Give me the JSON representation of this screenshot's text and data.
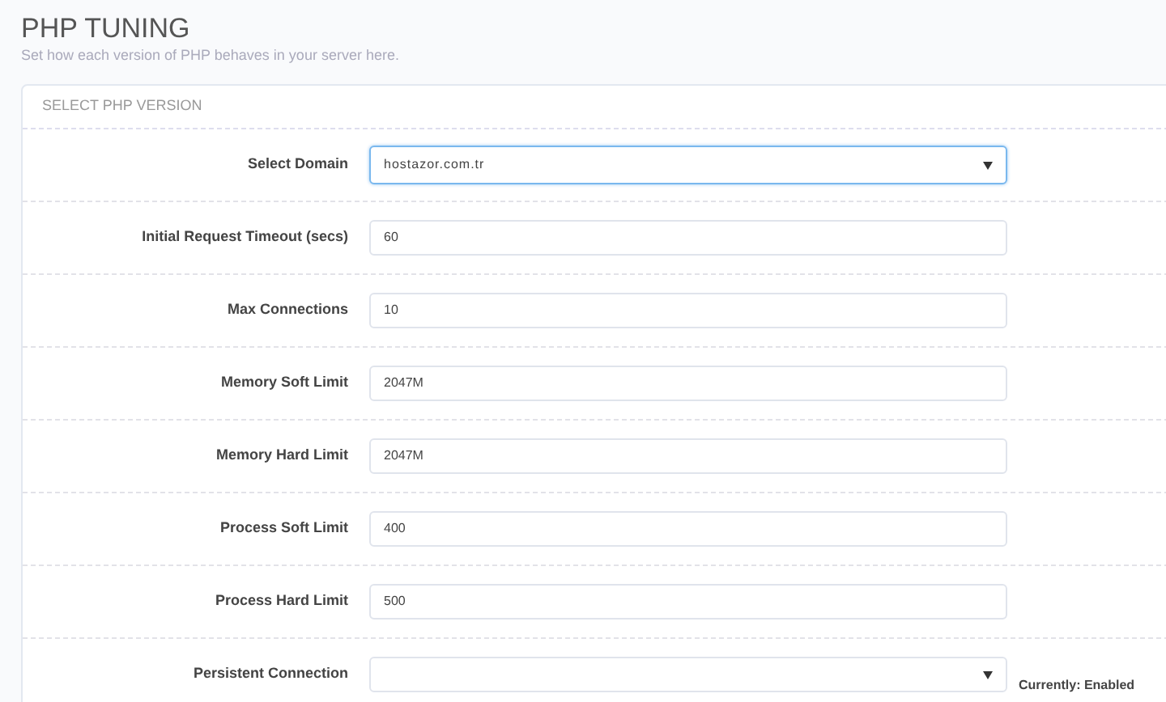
{
  "page": {
    "title": "PHP TUNING",
    "subtitle": "Set how each version of PHP behaves in your server here."
  },
  "card": {
    "header": "SELECT PHP VERSION",
    "fields": [
      {
        "kind": "select",
        "label": "Select Domain",
        "value": "hostazor.com.tr",
        "focused": true
      },
      {
        "kind": "input",
        "label": "Initial Request Timeout (secs)",
        "value": "60",
        "focused": false
      },
      {
        "kind": "input",
        "label": "Max Connections",
        "value": "10",
        "focused": false
      },
      {
        "kind": "input",
        "label": "Memory Soft Limit",
        "value": "2047M",
        "focused": false
      },
      {
        "kind": "input",
        "label": "Memory Hard Limit",
        "value": "2047M",
        "focused": false
      },
      {
        "kind": "input",
        "label": "Process Soft Limit",
        "value": "400",
        "focused": false
      },
      {
        "kind": "input",
        "label": "Process Hard Limit",
        "value": "500",
        "focused": false
      },
      {
        "kind": "select",
        "label": "Persistent Connection",
        "focused": false,
        "note": "Currently: Enabled"
      }
    ]
  }
}
